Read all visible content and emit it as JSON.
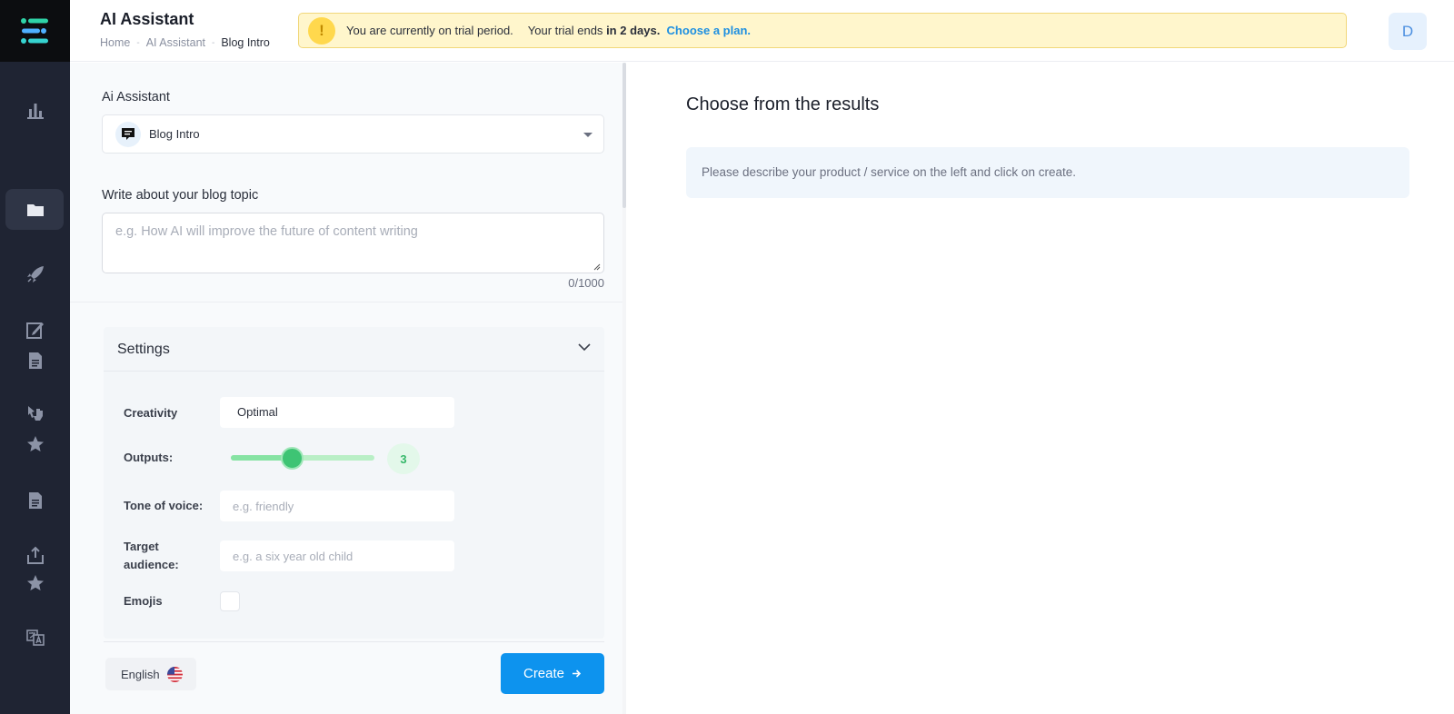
{
  "header": {
    "title": "AI Assistant",
    "breadcrumb": [
      "Home",
      "AI Assistant",
      "Blog Intro"
    ],
    "breadcrumb_separator": "-",
    "trial": {
      "icon": "!",
      "message": "You are currently on trial period.",
      "ends_prefix": "Your trial ends",
      "ends_value": "in 2 days.",
      "link": "Choose a plan."
    },
    "avatar_initial": "D"
  },
  "sidebar": {
    "icons": [
      "logo-icon",
      "chart-bar-icon",
      "folder-icon",
      "rocket-icon",
      "edit-icon",
      "document-icon",
      "cursor-hand-icon",
      "star-icon",
      "document-icon",
      "share-icon",
      "star-icon",
      "translate-icon"
    ],
    "active_item": "folder-icon"
  },
  "form": {
    "assistant_label": "Ai Assistant",
    "assistant_selected": "Blog Intro",
    "topic_label": "Write about your blog topic",
    "topic_placeholder": "e.g. How AI will improve the future of content writing",
    "topic_counter": "0/1000",
    "settings": {
      "title": "Settings",
      "creativity_label": "Creativity",
      "creativity_value": "Optimal",
      "outputs_label": "Outputs:",
      "outputs_value": "3",
      "outputs_level_fraction": 0.43,
      "tone_label": "Tone of voice:",
      "tone_placeholder": "e.g. friendly",
      "audience_label_line1": "Target",
      "audience_label_line2": "audience:",
      "audience_placeholder": "e.g. a six year old child",
      "emojis_label": "Emojis",
      "emojis_checked": false
    },
    "language": "English",
    "create_label": "Create"
  },
  "results": {
    "title": "Choose from the results",
    "empty_message": "Please describe your product / service on the left and click on create."
  },
  "colors": {
    "sidebar_bg": "#1f2433",
    "accent_blue": "#0d93ee",
    "slider_green": "#3ec474",
    "trial_bg": "#fff6cc"
  }
}
